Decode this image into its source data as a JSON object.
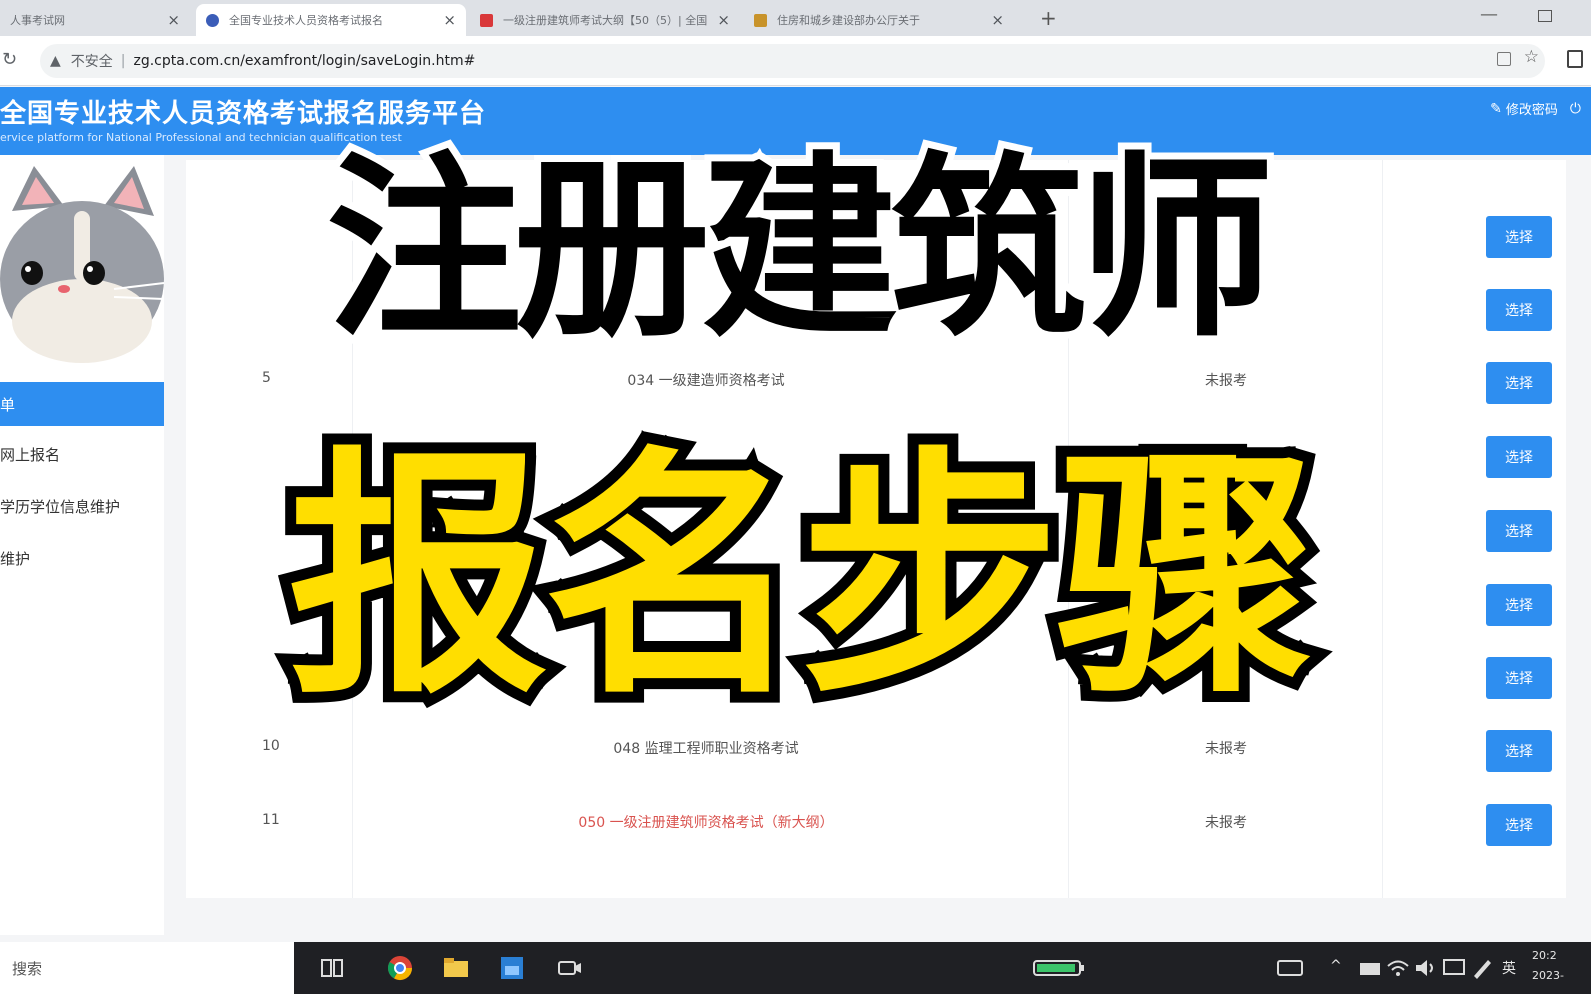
{
  "browser": {
    "tabs": [
      {
        "title": "人事考试网",
        "active": false
      },
      {
        "title": "全国专业技术人员资格考试报名",
        "active": true
      },
      {
        "title": "一级注册建筑师考试大纲【50（5）| 全国",
        "active": false
      },
      {
        "title": "住房和城乡建设部办公厅关于",
        "active": false
      }
    ],
    "new_tab_label": "+",
    "security_label": "不安全",
    "separator": "|",
    "url": "zg.cpta.com.cn/examfront/login/saveLogin.htm#"
  },
  "header": {
    "title": "全国专业技术人员资格考试报名服务平台",
    "subtitle": "ervice platform for National Professional and technician qualification test",
    "edit_password_label": "修改密码"
  },
  "sidebar": {
    "items": [
      {
        "label": "单",
        "active": true
      },
      {
        "label": "网上报名",
        "active": false
      },
      {
        "label": "学历学位信息维护",
        "active": false
      },
      {
        "label": "维护",
        "active": false
      }
    ]
  },
  "main": {
    "select_label": "选择",
    "rows": [
      {
        "num": "5",
        "name": "034 一级建造师资格考试",
        "status": "未报考",
        "highlight": false
      },
      {
        "num": "10",
        "name": "048 监理工程师职业资格考试",
        "status": "未报考",
        "highlight": false
      },
      {
        "num": "11",
        "name": "050 一级注册建筑师资格考试（新大纲）",
        "status": "未报考",
        "highlight": true
      }
    ]
  },
  "overlay": {
    "line1": "注册建筑师",
    "line2": "报名步骤",
    "line1_color": "#000000",
    "line2_color": "#ffde00"
  },
  "taskbar": {
    "search_placeholder": "搜索",
    "ime_label": "英",
    "clock_time": "20:2",
    "clock_date": "2023-"
  },
  "colors": {
    "accent": "#2e8ef0",
    "highlight_text": "#d9534f"
  }
}
